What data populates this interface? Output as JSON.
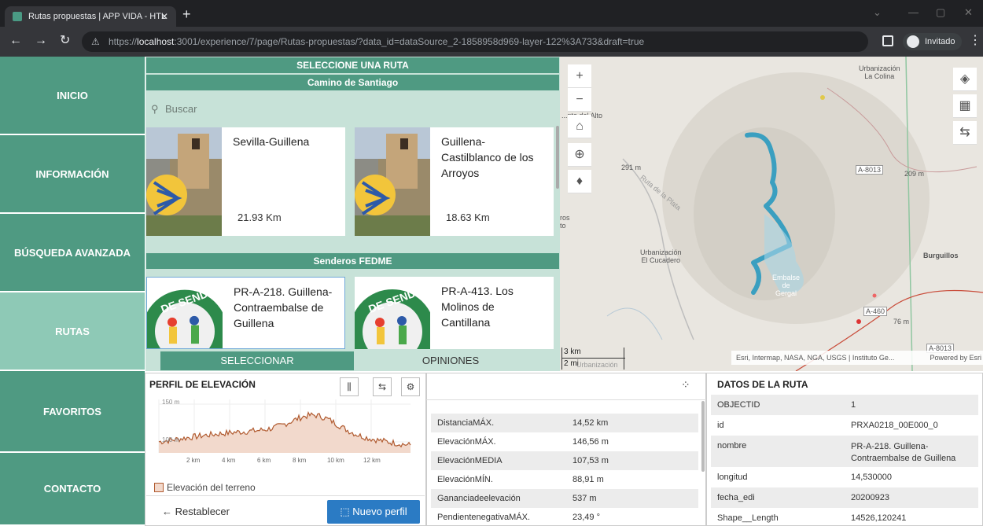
{
  "browser": {
    "tab_title": "Rutas propuestas | APP VIDA - HTL",
    "url_pre": "https://",
    "url_host": "localhost",
    "url_rest": ":3001/experience/7/page/Rutas-propuestas/?data_id=dataSource_2-1858958d969-layer-122%3A733&draft=true",
    "profile": "Invitado"
  },
  "sidebar": {
    "items": [
      {
        "label": "INICIO"
      },
      {
        "label": "INFORMACIÓN"
      },
      {
        "label": "BÚSQUEDA AVANZADA"
      },
      {
        "label": "RUTAS"
      },
      {
        "label": "FAVORITOS"
      },
      {
        "label": "CONTACTO"
      }
    ]
  },
  "routes": {
    "header": "SELECCIONE UNA RUTA",
    "group1": "Camino de Santiago",
    "search_placeholder": "Buscar",
    "cards1": [
      {
        "title": "Sevilla-Guillena",
        "km": "21.93  Km"
      },
      {
        "title": "Guillena-Castilblanco de los Arroyos",
        "km": "18.63  Km"
      }
    ],
    "group2": "Senderos FEDME",
    "cards2": [
      {
        "title": "PR-A-218. Guillena-Contraembalse de Guillena",
        "badge": "DE SENDER"
      },
      {
        "title": "PR-A-413. Los Molinos de Cantillana",
        "badge": "DE SENDER"
      }
    ],
    "tab_select": "SELECCIONAR",
    "tab_opinions": "OPINIONES"
  },
  "map": {
    "labels": {
      "alto": "...nte del Alto",
      "m291": "291 m",
      "plata": "Ruta de la Plata",
      "urb_colina": "Urbanización\nLa Colina",
      "a8013": "A-8013",
      "m209": "209 m",
      "urb_cucadero": "Urbanización\nEl Cucadero",
      "burguillos": "Burguillos",
      "embalse": "Embalse\nde\nGergal",
      "a460": "A-460",
      "m76": "76 m",
      "a8013b": "A-8013",
      "ros": "ros\nto"
    },
    "scale_km": "3 km",
    "scale_mi": "2 mi",
    "scale_extra": "Urbanización",
    "attribution": "Esri, Intermap, NASA, NGA, USGS | Instituto Ge...",
    "powered": "Powered by Esri"
  },
  "elevation": {
    "title": "PERFIL DE ELEVACIÓN",
    "y_top": "150 m",
    "y_mid": "100 m",
    "x_ticks": [
      "2 km",
      "4 km",
      "6 km",
      "8 km",
      "10 km",
      "12 km"
    ],
    "legend": "Elevación del terreno",
    "reset": "Restablecer",
    "new_profile": "Nuevo perfil",
    "line_color": "#b05a2f"
  },
  "stats": {
    "rows": [
      {
        "k": "DistanciaMÁX.",
        "v": "14,52 km"
      },
      {
        "k": "ElevaciónMÁX.",
        "v": "146,56 m"
      },
      {
        "k": "ElevaciónMEDIA",
        "v": "107,53 m"
      },
      {
        "k": "ElevaciónMÍN.",
        "v": "88,91 m"
      },
      {
        "k": "Gananciadeelevación",
        "v": "537 m"
      },
      {
        "k": "PendientenegativaMÁX.",
        "v": "23,49 °"
      }
    ]
  },
  "datos": {
    "title": "DATOS DE LA RUTA",
    "rows": [
      {
        "k": "OBJECTID",
        "v": "1"
      },
      {
        "k": "id",
        "v": "PRXA0218_00E000_0"
      },
      {
        "k": "nombre",
        "v": "PR-A-218. Guillena-Contraembalse de Guillena"
      },
      {
        "k": "longitud",
        "v": "14,530000"
      },
      {
        "k": "fecha_edi",
        "v": "20200923"
      },
      {
        "k": "Shape__Length",
        "v": "14526,120241"
      }
    ]
  },
  "colors": {
    "primary": "#4f9a82",
    "light": "#c7e2d8",
    "active": "#8ec9b6",
    "route": "#3a9fc0",
    "button": "#2b7bc4"
  }
}
